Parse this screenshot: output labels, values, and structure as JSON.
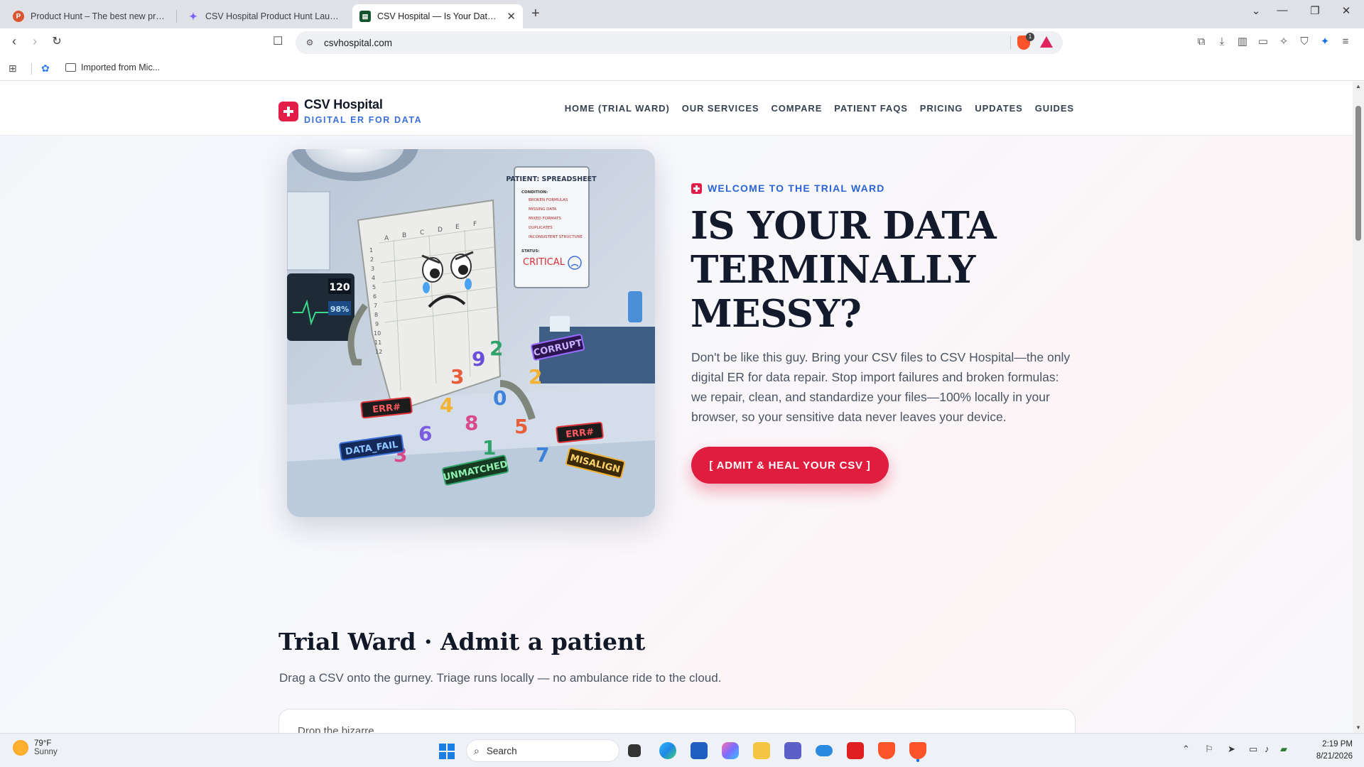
{
  "browser": {
    "tabs": [
      {
        "title": "Product Hunt – The best new products",
        "favicon_color": "#da552f",
        "favicon_letter": "P"
      },
      {
        "title": "CSV Hospital Product Hunt Launch -",
        "favicon_color": "#7b61ff",
        "favicon_letter": "✦"
      },
      {
        "title": "CSV Hospital — Is Your Data Terminally Messy?",
        "favicon_color": "#14532d",
        "favicon_letter": "▤"
      }
    ],
    "url": "csvhospital.com",
    "shield_count": "1",
    "bookmarks": {
      "folder_label": "Imported from Mic..."
    }
  },
  "site": {
    "logo_name": "CSV Hospital",
    "logo_tagline": "DIGITAL ER FOR DATA",
    "nav": [
      "HOME (TRIAL WARD)",
      "OUR SERVICES",
      "COMPARE",
      "PATIENT FAQS",
      "PRICING",
      "UPDATES",
      "GUIDES"
    ],
    "hero": {
      "eyebrow": "WELCOME TO THE TRIAL WARD",
      "title": "IS YOUR DATA TERMINALLY MESSY?",
      "body": "Don't be like this guy. Bring your CSV files to CSV Hospital—the only digital ER for data repair. Stop import failures and broken formulas: we repair, clean, and standardize your files—100% locally in your browser, so your sensitive data never leaves your device.",
      "cta": "[ ADMIT & HEAL YOUR CSV ]",
      "image": {
        "chart_title": "PATIENT: SPREADSHEET",
        "condition_label": "CONDITION:",
        "conditions": [
          "BROKEN FORMULAS",
          "MISSING DATA",
          "MIXED FORMATS",
          "DUPLICATES",
          "INCONSISTENT STRUCTURE"
        ],
        "status_label": "STATUS:",
        "status": "CRITICAL",
        "monitor_top": "120",
        "monitor_bottom": "98%",
        "columns": [
          "A",
          "B",
          "C",
          "D",
          "E",
          "F"
        ],
        "rows": [
          "1",
          "2",
          "3",
          "4",
          "5",
          "6",
          "7",
          "8",
          "9",
          "10",
          "11",
          "12"
        ],
        "tags": [
          "ERR#",
          "DATA_FAIL",
          "UNMATCHED",
          "CORRUPT",
          "ERR#",
          "MISALIGN"
        ]
      }
    },
    "trial": {
      "title": "Trial Ward · Admit a patient",
      "subtitle": "Drag a CSV onto the gurney. Triage runs locally — no ambulance ride to the cloud.",
      "dropzone_hint": "Drop the bizarre... "
    }
  },
  "taskbar": {
    "weather_temp": "79°F",
    "weather_condition": "Sunny",
    "search_label": "Search",
    "time": "2:19 PM",
    "date": "8/21/2026"
  }
}
